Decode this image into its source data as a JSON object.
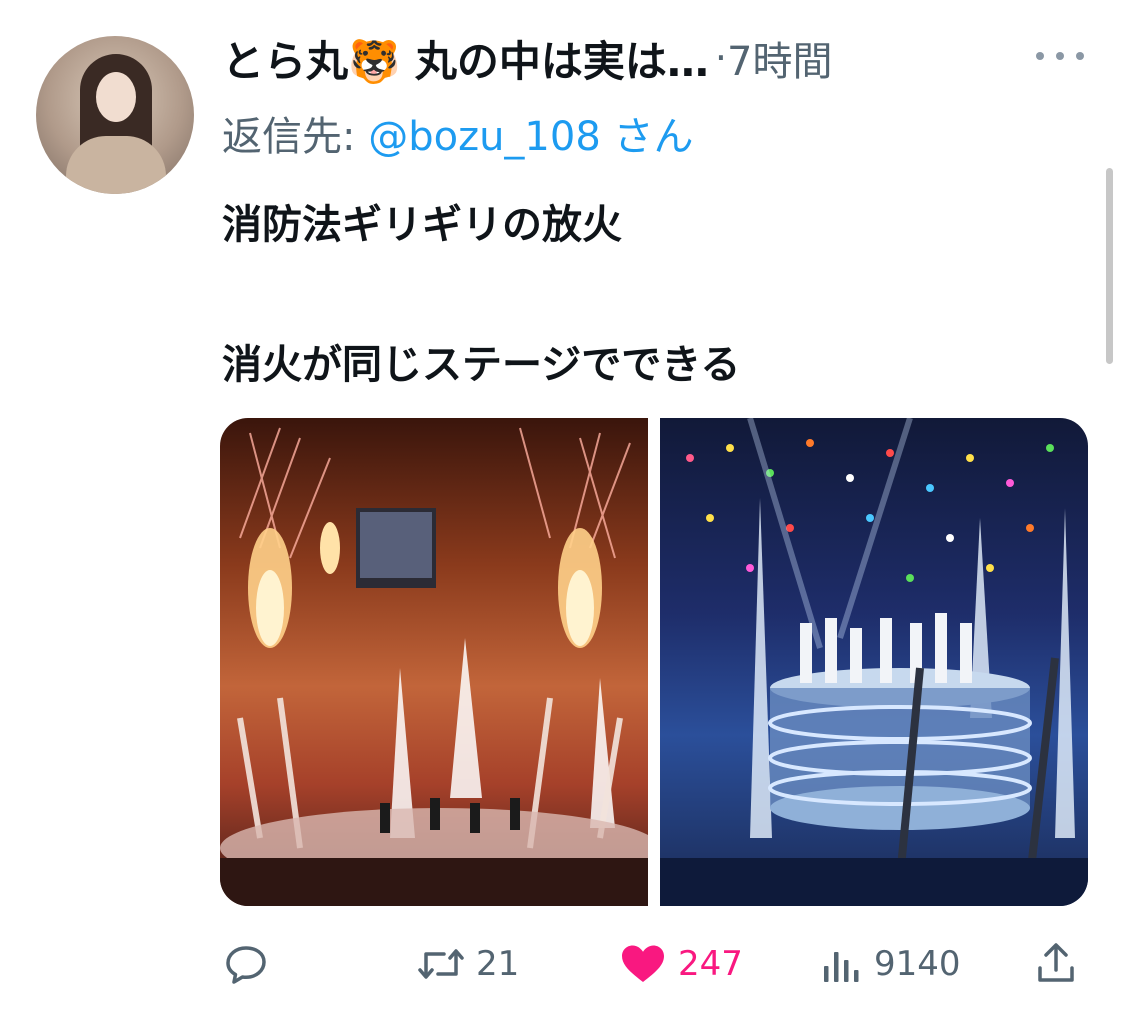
{
  "tweet": {
    "author_name": "とら丸🐯 丸の中は実は…",
    "separator": "·",
    "time": "7時間",
    "reply_label": "返信先: ",
    "reply_handle": "@bozu_108 さん",
    "text_line1": "消防法ギリギリの放火",
    "text_line2": "消火が同じステージでできる",
    "media": [
      {
        "alt": "concert stage with fireworks and flames"
      },
      {
        "alt": "concert stage with water fountains and confetti"
      }
    ]
  },
  "actions": {
    "retweets": "21",
    "likes": "247",
    "views": "9140"
  },
  "colors": {
    "secondary": "#536471",
    "link": "#1d9bf0",
    "like": "#f91880",
    "text": "#0f1419"
  }
}
